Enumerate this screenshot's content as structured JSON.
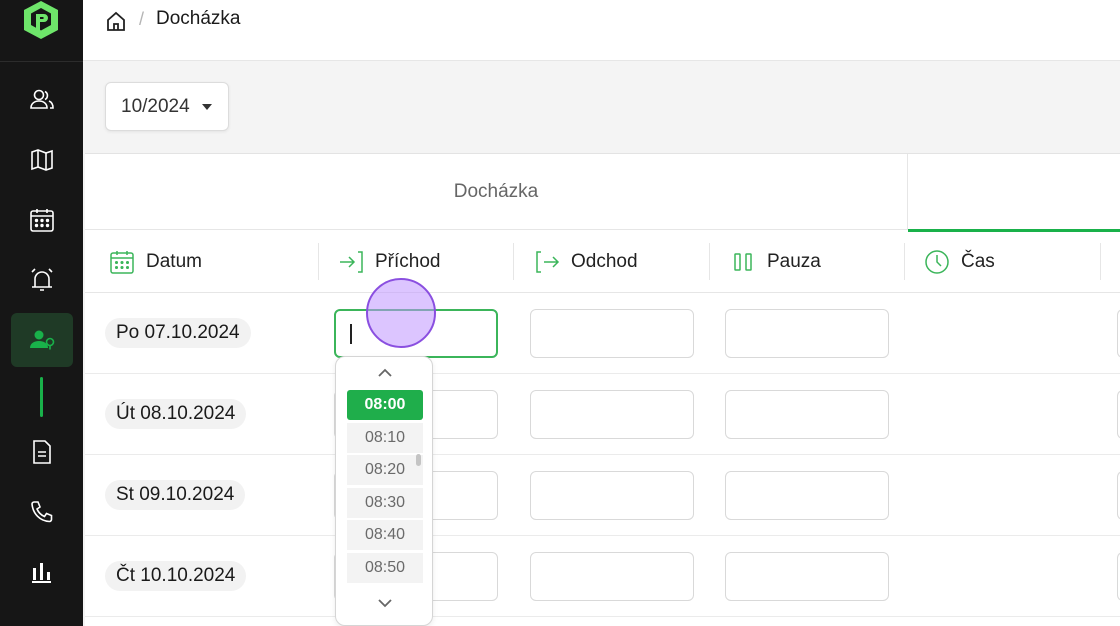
{
  "breadcrumb": {
    "home_icon": "home-icon",
    "separator": "/",
    "title": "Docházka"
  },
  "sidebar": {
    "logo": "app-logo",
    "items": [
      {
        "icon": "users-icon"
      },
      {
        "icon": "map-icon"
      },
      {
        "icon": "calendar-icon"
      },
      {
        "icon": "alarm-bell-icon"
      },
      {
        "icon": "user-location-icon",
        "active": true
      },
      {
        "icon": "document-icon"
      },
      {
        "icon": "phone-icon"
      },
      {
        "icon": "bar-chart-icon"
      }
    ],
    "accent_color": "#19b14a"
  },
  "month_select": {
    "value": "10/2024"
  },
  "tabs": [
    {
      "label": "Docházka"
    },
    {
      "label": "",
      "active": true
    }
  ],
  "table": {
    "columns": [
      {
        "label": "Datum",
        "icon": "calendar-icon"
      },
      {
        "label": "Příchod",
        "icon": "arrival-icon"
      },
      {
        "label": "Odchod",
        "icon": "departure-icon"
      },
      {
        "label": "Pauza",
        "icon": "pause-icon"
      },
      {
        "label": "Čas",
        "icon": "clock-icon"
      }
    ],
    "rows": [
      {
        "date": "Po 07.10.2024"
      },
      {
        "date": "Út 08.10.2024"
      },
      {
        "date": "St 09.10.2024"
      },
      {
        "date": "Čt 10.10.2024"
      }
    ]
  },
  "time_dropdown": {
    "options": [
      "08:00",
      "08:10",
      "08:20",
      "08:30",
      "08:40",
      "08:50"
    ],
    "selected": "08:00",
    "selected_color": "#1fae4b"
  }
}
